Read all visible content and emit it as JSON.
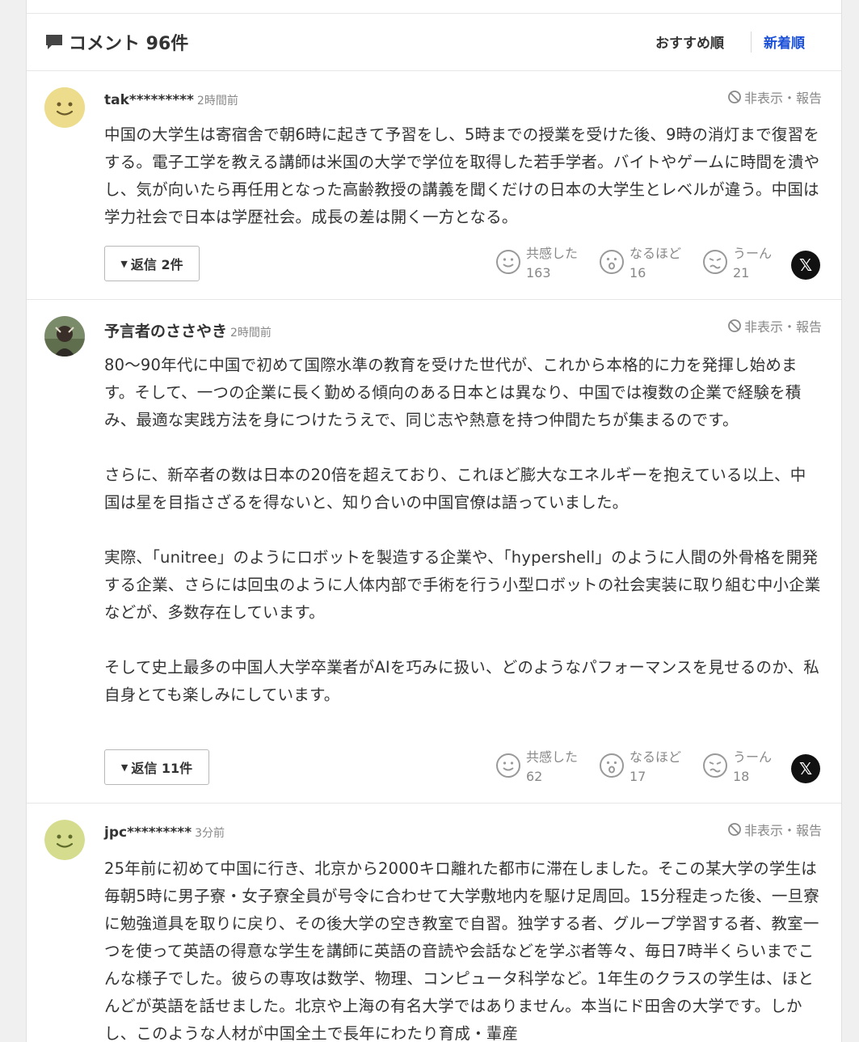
{
  "header": {
    "title": "コメント 96件",
    "sort_recommended": "おすすめ順",
    "sort_newest": "新着順"
  },
  "comments": [
    {
      "user": "tak*********",
      "time": "2時間前",
      "report": "非表示・報告",
      "paragraphs": [
        "中国の大学生は寄宿舎で朝6時に起きて予習をし、5時までの授業を受けた後、9時の消灯まで復習をする。電子工学を教える講師は米国の大学で学位を取得した若手学者。バイトやゲームに時間を潰やし、気が向いたら再任用となった高齢教授の講義を聞くだけの日本の大学生とレベルが違う。中国は学力社会で日本は学歴社会。成長の差は開く一方となる。"
      ],
      "reply_label": "返信 2件",
      "reactions": [
        {
          "label": "共感した",
          "count": "163"
        },
        {
          "label": "なるほど",
          "count": "16"
        },
        {
          "label": "うーん",
          "count": "21"
        }
      ]
    },
    {
      "user": "予言者のささやき",
      "time": "2時間前",
      "report": "非表示・報告",
      "paragraphs": [
        "80〜90年代に中国で初めて国際水準の教育を受けた世代が、これから本格的に力を発揮し始めます。そして、一つの企業に長く勤める傾向のある日本とは異なり、中国では複数の企業で経験を積み、最適な実践方法を身につけたうえで、同じ志や熱意を持つ仲間たちが集まるのです。",
        "さらに、新卒者の数は日本の20倍を超えており、これほど膨大なエネルギーを抱えている以上、中国は星を目指さざるを得ないと、知り合いの中国官僚は語っていました。",
        "実際、「unitree」のようにロボットを製造する企業や、「hypershell」のように人間の外骨格を開発する企業、さらには回虫のように人体内部で手術を行う小型ロボットの社会実装に取り組む中小企業などが、多数存在しています。",
        "そして史上最多の中国人大学卒業者がAIを巧みに扱い、どのようなパフォーマンスを見せるのか、私自身とても楽しみにしています。"
      ],
      "reply_label": "返信 11件",
      "reactions": [
        {
          "label": "共感した",
          "count": "62"
        },
        {
          "label": "なるほど",
          "count": "17"
        },
        {
          "label": "うーん",
          "count": "18"
        }
      ]
    },
    {
      "user": "jpc*********",
      "time": "3分前",
      "report": "非表示・報告",
      "paragraphs": [
        "25年前に初めて中国に行き、北京から2000キロ離れた都市に滞在しました。そこの某大学の学生は毎朝5時に男子寮・女子寮全員が号令に合わせて大学敷地内を駆け足周回。15分程走った後、一旦寮に勉強道具を取りに戻り、その後大学の空き教室で自習。独学する者、グループ学習する者、教室一つを使って英語の得意な学生を講師に英語の音読や会話などを学ぶ者等々、毎日7時半くらいまでこんな様子でした。彼らの専攻は数学、物理、コンピュータ科学など。1年生のクラスの学生は、ほとんどが英語を話せました。北京や上海の有名大学ではありません。本当にド田舎の大学です。しかし、このような人材が中国全土で長年にわたり育成・輩産"
      ]
    }
  ]
}
